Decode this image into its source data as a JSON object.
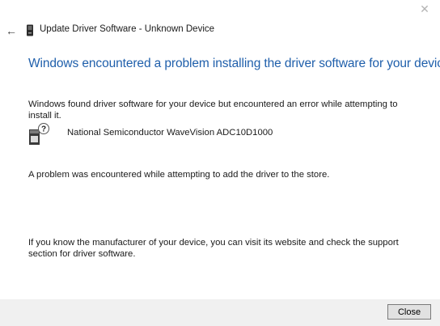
{
  "window": {
    "close_glyph": "✕",
    "title": "Update Driver Software - Unknown Device"
  },
  "nav": {
    "back_glyph": "←"
  },
  "content": {
    "heading": "Windows encountered a problem installing the driver software for your device",
    "found_text": "Windows found driver software for your device but encountered an error while attempting to install it.",
    "device_name": "National Semiconductor WaveVision ADC10D1000",
    "error_text": "A problem was encountered while attempting to add the driver to the store.",
    "help_text": "If you know the manufacturer of your device, you can visit its website and check the support section for driver software."
  },
  "footer": {
    "close_label": "Close"
  },
  "colors": {
    "heading": "#1f5fab",
    "footer_bg": "#f0f0f0",
    "button_bg": "#e1e1e1"
  },
  "icons": {
    "title_icon": "device-manager-icon",
    "device_icon": "unknown-device-icon"
  }
}
